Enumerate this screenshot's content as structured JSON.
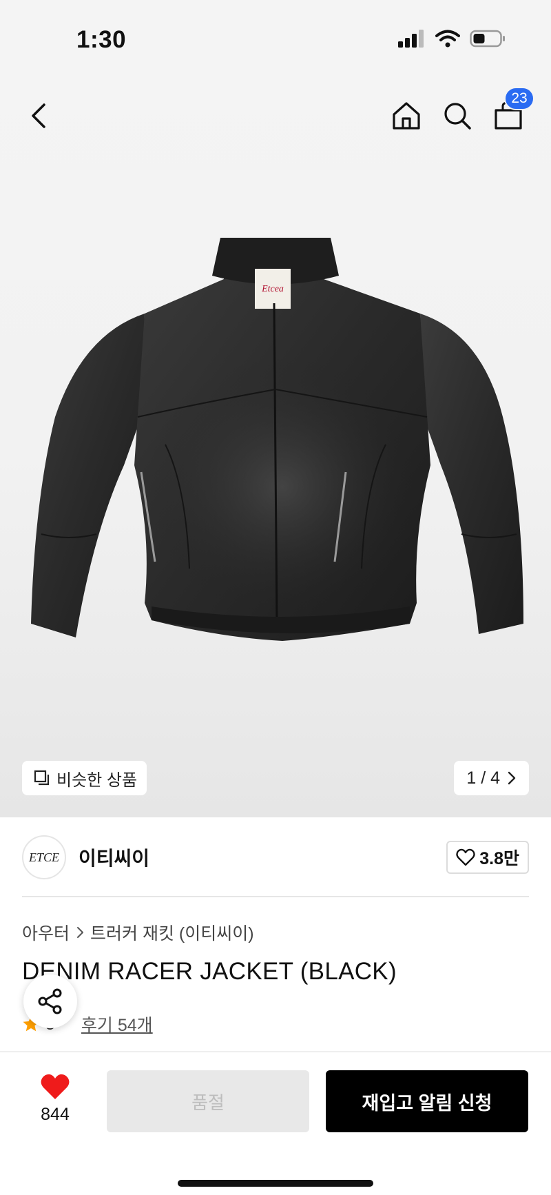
{
  "status": {
    "time": "1:30"
  },
  "nav": {
    "cart_count": "23"
  },
  "gallery": {
    "similar_label": "비슷한 상품",
    "page_indicator": "1 / 4",
    "image_label": "Etcea"
  },
  "brand": {
    "logo_text": "ETCE",
    "name": "이티씨이",
    "likes": "3.8만"
  },
  "breadcrumb": [
    "아우터",
    "트러커 재킷 (이티씨이)"
  ],
  "product": {
    "title": "DENIM RACER JACKET (BLACK)",
    "rating_partial": "5",
    "reviews_label": "후기 54개"
  },
  "bottom_bar": {
    "like_count": "844",
    "soldout_label": "품절",
    "restock_label": "재입고 알림 신청"
  },
  "colors": {
    "accent_blue": "#2a6bf2",
    "heart_red": "#ef1b1b",
    "star_orange": "#ff9f00"
  }
}
